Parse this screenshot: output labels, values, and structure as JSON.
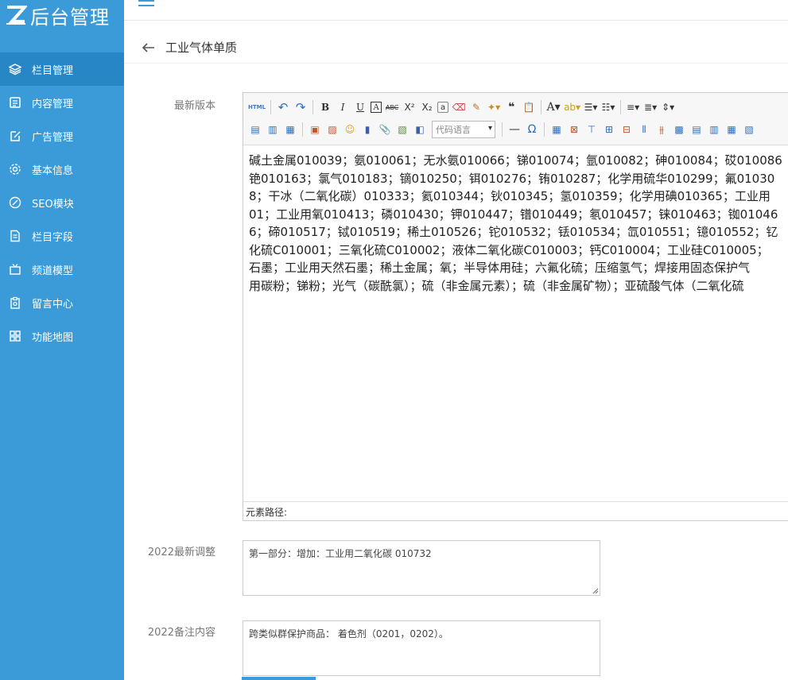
{
  "app": {
    "logo_text": "后台管理",
    "accent": "#3a9bd8",
    "active_bg": "#2686c6"
  },
  "sidebar": {
    "items": [
      {
        "label": "栏目管理",
        "icon": "layers-icon",
        "active": true
      },
      {
        "label": "内容管理",
        "icon": "document-list-icon"
      },
      {
        "label": "广告管理",
        "icon": "edit-box-icon"
      },
      {
        "label": "基本信息",
        "icon": "gear-icon"
      },
      {
        "label": "SEO模块",
        "icon": "link-circle-icon"
      },
      {
        "label": "栏目字段",
        "icon": "file-text-icon"
      },
      {
        "label": "频道模型",
        "icon": "tv-icon"
      },
      {
        "label": "留言中心",
        "icon": "clipboard-icon"
      },
      {
        "label": "功能地图",
        "icon": "grid-icon"
      }
    ]
  },
  "page": {
    "title": "工业气体单质"
  },
  "form": {
    "latest_version_label": "最新版本",
    "editor": {
      "code_lang_placeholder": "代码语言",
      "status_label": "元素路径:",
      "lines": [
        "碱土金属010039；氨010061；无水氨010066；锑010074；氩010082；砷010084；砹010086",
        "铯010163；氯气010183；镝010250；铒010276；铕010287；化学用硫华010299；氟01030",
        "8；干冰（二氧化碳）010333；氦010344；钬010345；氢010359；化学用碘010365；工业用",
        "01；工业用氧010413；磷010430；钾010447；镨010449；氡010457；铼010463；铷01046",
        "6；碲010517；铽010519；稀土010526；铊010532；铥010534；氙010551；镱010552；钇",
        "化硫C010001；三氧化硫C010002；液体二氧化碳C010003；钙C010004；工业硅C010005；",
        "石墨；工业用天然石墨；稀土金属；氧；半导体用硅；六氟化硫；压缩氢气；焊接用固态保护气",
        "用碳粉；锑粉；光气（碳酰氯）；硫（非金属元素）；硫（非金属矿物）；亚硫酸气体（二氧化硫"
      ]
    },
    "adjust_label": "2022最新调整",
    "adjust_value": "第一部分：增加：工业用二氧化碳 010732",
    "note_label": "2022备注内容",
    "note_value": "跨类似群保护商品： 着色剂（0201，0202）。"
  }
}
